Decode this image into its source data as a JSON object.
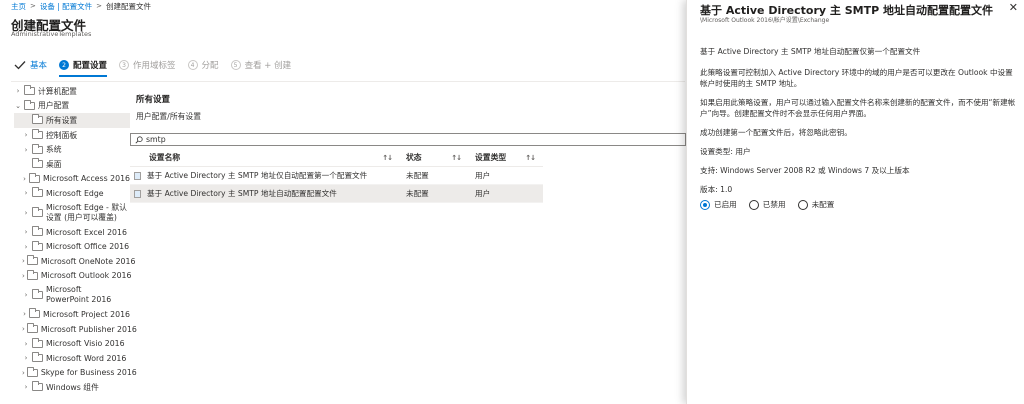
{
  "breadcrumb": {
    "home": "主页",
    "devices": "设备 | 配置文件",
    "current": "创建配置文件"
  },
  "page": {
    "title": "创建配置文件",
    "subtitle": "AdministrativeTemplates"
  },
  "steps": [
    {
      "label": "基本",
      "state": "done"
    },
    {
      "label": "配置设置",
      "number": "2",
      "state": "active"
    },
    {
      "label": "作用域标签",
      "number": "3",
      "state": "pending"
    },
    {
      "label": "分配",
      "number": "4",
      "state": "pending"
    },
    {
      "label": "查看 + 创建",
      "number": "5",
      "state": "pending"
    }
  ],
  "tree": {
    "computer_config": "计算机配置",
    "user_config": "用户配置",
    "all_settings": "所有设置",
    "control_panel": "控制面板",
    "system": "系统",
    "desktop": "桌面",
    "items": [
      "Microsoft Access 2016",
      "Microsoft Edge",
      "Microsoft Edge - 默认设置 (用户可以覆盖)",
      "Microsoft Excel 2016",
      "Microsoft Office 2016",
      "Microsoft OneNote 2016",
      "Microsoft Outlook 2016",
      "Microsoft PowerPoint 2016",
      "Microsoft Project 2016",
      "Microsoft Publisher 2016",
      "Microsoft Visio 2016",
      "Microsoft Word 2016",
      "Skype for Business 2016",
      "Windows 组件"
    ]
  },
  "center": {
    "heading": "所有设置",
    "path": "用户配置/所有设置",
    "search_value": "smtp"
  },
  "grid": {
    "headers": {
      "name": "设置名称",
      "state": "状态",
      "type": "设置类型"
    },
    "rows": [
      {
        "name": "基于 Active Directory 主 SMTP 地址仅自动配置第一个配置文件",
        "state": "未配置",
        "type": "用户"
      },
      {
        "name": "基于 Active Directory 主 SMTP 地址自动配置配置文件",
        "state": "未配置",
        "type": "用户"
      }
    ]
  },
  "panel": {
    "title": "基于 Active Directory 主 SMTP 地址自动配置配置文件",
    "path": "\\Microsoft Outlook 2016\\帐户设置\\Exchange",
    "close": "✕",
    "p1": "基于 Active Directory 主 SMTP 地址自动配置仅第一个配置文件",
    "p2": "此策略设置可控制加入 Active Directory 环境中的域的用户是否可以更改在 Outlook 中设置帐户时使用的主 SMTP 地址。",
    "p3": "如果启用此策略设置，用户可以通过输入配置文件名称来创建新的配置文件，而不使用“新建帐户”向导。创建配置文件时不会显示任何用户界面。",
    "p4": "成功创建第一个配置文件后，将忽略此密钥。",
    "setting_type": "设置类型: 用户",
    "support": "支持: Windows Server 2008 R2 或 Windows 7 及以上版本",
    "version": "版本: 1.0",
    "options": {
      "enabled": "已启用",
      "disabled": "已禁用",
      "not_configured": "未配置"
    },
    "selected_option": "enabled"
  },
  "colors": {
    "accent": "#0078d4"
  }
}
